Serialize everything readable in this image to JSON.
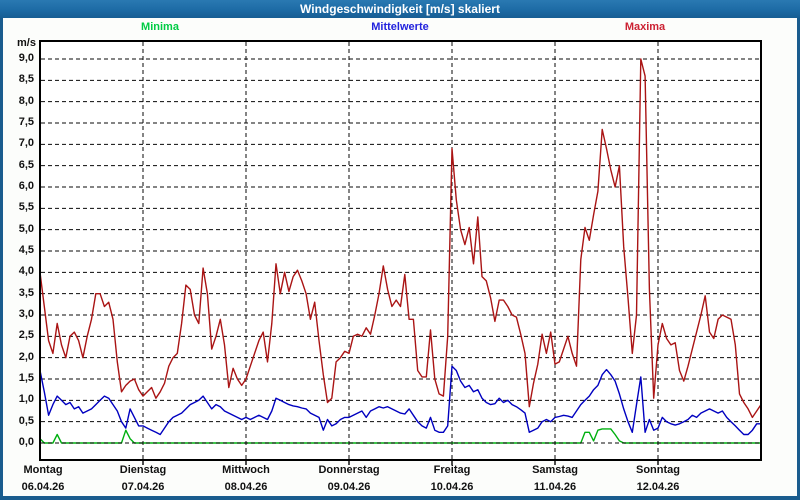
{
  "window": {
    "title": "Windgeschwindigkeit [m/s] skaliert"
  },
  "legend": [
    {
      "label": "Minima",
      "color": "#00cc44"
    },
    {
      "label": "Mittelwerte",
      "color": "#2222dd"
    },
    {
      "label": "Maxima",
      "color": "#cc2233"
    }
  ],
  "y_axis": {
    "unit": "m/s",
    "min": 0,
    "max": 9,
    "step": 0.5,
    "tick_labels": [
      "9,0",
      "8,5",
      "8,0",
      "7,5",
      "7,0",
      "6,5",
      "6,0",
      "5,5",
      "5,0",
      "4,5",
      "4,0",
      "3,5",
      "3,0",
      "2,5",
      "2,0",
      "1,5",
      "1,0",
      "0,5",
      "0,0"
    ]
  },
  "x_axis": {
    "days": [
      {
        "name": "Montag",
        "date": "06.04.26"
      },
      {
        "name": "Dienstag",
        "date": "07.04.26"
      },
      {
        "name": "Mittwoch",
        "date": "08.04.26"
      },
      {
        "name": "Donnerstag",
        "date": "09.04.26"
      },
      {
        "name": "Freitag",
        "date": "10.04.26"
      },
      {
        "name": "Samstag",
        "date": "11.04.26"
      },
      {
        "name": "Sonntag",
        "date": "12.04.26"
      }
    ]
  },
  "chart_data": {
    "type": "line",
    "title": "Windgeschwindigkeit [m/s] skaliert",
    "ylabel": "m/s",
    "ylim": [
      0,
      9
    ],
    "grid": true,
    "points_per_day": 24,
    "n_points": 169,
    "x_unit": "hours, Montag 06.04.26 00:00 bis Sonntag 12.04.26 24:00",
    "series": [
      {
        "name": "Maxima",
        "color": "#aa1414",
        "values": [
          4.0,
          3.2,
          2.4,
          2.1,
          2.8,
          2.3,
          2.0,
          2.5,
          2.6,
          2.4,
          2.0,
          2.5,
          2.9,
          3.5,
          3.5,
          3.2,
          3.3,
          2.9,
          1.9,
          1.2,
          1.35,
          1.45,
          1.5,
          1.25,
          1.1,
          1.2,
          1.3,
          1.05,
          1.2,
          1.4,
          1.8,
          2.0,
          2.1,
          2.8,
          3.7,
          3.6,
          3.0,
          2.8,
          4.1,
          3.5,
          2.2,
          2.5,
          2.9,
          2.3,
          1.3,
          1.75,
          1.5,
          1.35,
          1.5,
          1.8,
          2.1,
          2.4,
          2.6,
          1.9,
          2.8,
          4.2,
          3.5,
          4.0,
          3.55,
          3.9,
          4.05,
          3.8,
          3.5,
          2.9,
          3.3,
          2.4,
          1.6,
          0.95,
          1.05,
          1.9,
          2.0,
          2.15,
          2.1,
          2.5,
          2.55,
          2.5,
          2.7,
          2.55,
          3.0,
          3.5,
          4.15,
          3.6,
          3.2,
          3.35,
          3.2,
          3.95,
          2.9,
          2.9,
          1.7,
          1.55,
          1.55,
          2.65,
          1.5,
          1.15,
          1.1,
          2.5,
          6.9,
          5.7,
          5.0,
          4.65,
          5.05,
          4.2,
          5.3,
          3.9,
          3.8,
          3.4,
          2.85,
          3.35,
          3.35,
          3.2,
          3.0,
          2.95,
          2.55,
          2.1,
          0.85,
          1.4,
          1.85,
          2.55,
          2.1,
          2.6,
          1.85,
          1.9,
          2.2,
          2.5,
          2.1,
          1.8,
          4.3,
          5.05,
          4.75,
          5.35,
          5.9,
          7.35,
          6.9,
          6.4,
          6.0,
          6.5,
          4.6,
          3.4,
          2.1,
          3.0,
          9.0,
          8.6,
          3.6,
          1.05,
          2.3,
          2.8,
          2.45,
          2.3,
          2.35,
          1.7,
          1.45,
          1.8,
          2.2,
          2.6,
          3.0,
          3.45,
          2.6,
          2.45,
          2.9,
          3.0,
          2.95,
          2.9,
          2.3,
          1.15,
          0.95,
          0.8,
          0.6,
          0.75,
          0.9
        ]
      },
      {
        "name": "Mittelwerte",
        "color": "#0000c0",
        "values": [
          1.7,
          1.2,
          0.65,
          0.9,
          1.1,
          1.0,
          0.9,
          0.95,
          0.8,
          0.85,
          0.7,
          0.75,
          0.8,
          0.9,
          1.0,
          1.1,
          1.05,
          0.9,
          0.75,
          0.5,
          0.35,
          0.8,
          0.6,
          0.4,
          0.4,
          0.35,
          0.3,
          0.25,
          0.2,
          0.35,
          0.5,
          0.6,
          0.65,
          0.7,
          0.8,
          0.9,
          0.95,
          1.0,
          1.1,
          0.95,
          0.8,
          0.9,
          0.85,
          0.75,
          0.7,
          0.65,
          0.6,
          0.55,
          0.6,
          0.55,
          0.6,
          0.65,
          0.6,
          0.55,
          0.75,
          1.05,
          1.0,
          0.95,
          0.9,
          0.87,
          0.85,
          0.82,
          0.8,
          0.7,
          0.65,
          0.6,
          0.3,
          0.55,
          0.4,
          0.45,
          0.55,
          0.6,
          0.6,
          0.65,
          0.7,
          0.75,
          0.6,
          0.75,
          0.8,
          0.85,
          0.82,
          0.85,
          0.8,
          0.75,
          0.7,
          0.68,
          0.8,
          0.65,
          0.5,
          0.4,
          0.35,
          0.6,
          0.3,
          0.25,
          0.25,
          0.4,
          1.8,
          1.7,
          1.45,
          1.3,
          1.35,
          1.2,
          1.25,
          1.05,
          0.95,
          0.9,
          0.92,
          1.05,
          0.95,
          1.0,
          0.9,
          0.85,
          0.78,
          0.7,
          0.25,
          0.3,
          0.35,
          0.5,
          0.55,
          0.5,
          0.6,
          0.62,
          0.65,
          0.63,
          0.6,
          0.75,
          0.9,
          1.0,
          1.1,
          1.25,
          1.35,
          1.6,
          1.72,
          1.6,
          1.45,
          1.15,
          0.8,
          0.5,
          0.25,
          0.9,
          1.55,
          0.25,
          0.55,
          0.3,
          0.35,
          0.6,
          0.5,
          0.45,
          0.42,
          0.45,
          0.5,
          0.55,
          0.65,
          0.6,
          0.7,
          0.75,
          0.8,
          0.75,
          0.7,
          0.75,
          0.6,
          0.5,
          0.4,
          0.3,
          0.2,
          0.2,
          0.3,
          0.45,
          0.45
        ]
      },
      {
        "name": "Minima",
        "color": "#00b010",
        "values": [
          0.1,
          0,
          0,
          0,
          0.2,
          0,
          0,
          0,
          0,
          0,
          0,
          0,
          0,
          0,
          0,
          0,
          0,
          0,
          0,
          0,
          0.3,
          0.1,
          0,
          0,
          0,
          0,
          0,
          0,
          0,
          0,
          0,
          0,
          0,
          0,
          0,
          0,
          0,
          0,
          0,
          0,
          0,
          0,
          0,
          0,
          0,
          0,
          0,
          0,
          0,
          0,
          0,
          0,
          0,
          0,
          0,
          0,
          0,
          0,
          0,
          0,
          0,
          0,
          0,
          0,
          0,
          0,
          0,
          0,
          0,
          0,
          0,
          0,
          0,
          0,
          0,
          0,
          0,
          0,
          0,
          0,
          0,
          0,
          0,
          0,
          0,
          0,
          0,
          0,
          0,
          0,
          0,
          0,
          0,
          0,
          0,
          0,
          0,
          0,
          0,
          0,
          0,
          0,
          0,
          0,
          0,
          0,
          0,
          0,
          0,
          0,
          0,
          0,
          0,
          0,
          0,
          0,
          0,
          0,
          0,
          0,
          0,
          0,
          0,
          0,
          0,
          0,
          0,
          0.25,
          0.25,
          0.05,
          0.3,
          0.33,
          0.33,
          0.33,
          0.2,
          0.05,
          0,
          0,
          0,
          0,
          0,
          0,
          0,
          0,
          0,
          0,
          0,
          0,
          0,
          0,
          0,
          0,
          0,
          0,
          0,
          0,
          0,
          0,
          0,
          0,
          0,
          0,
          0,
          0,
          0,
          0,
          0,
          0,
          0
        ]
      }
    ]
  }
}
